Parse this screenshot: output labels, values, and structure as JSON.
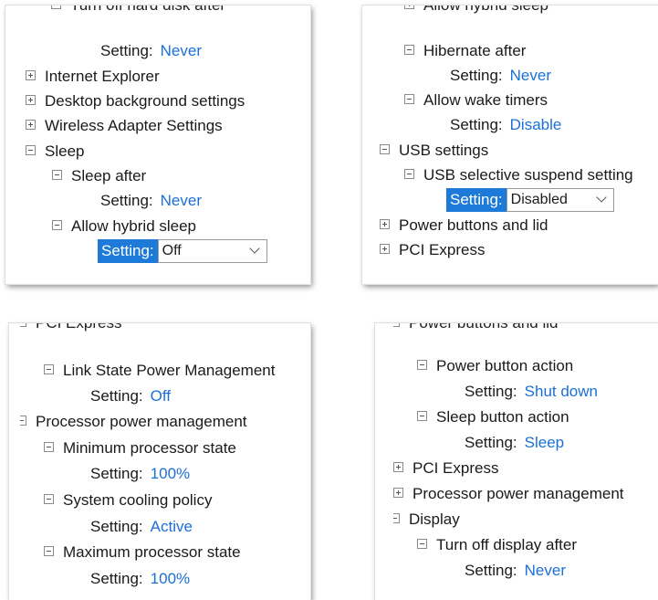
{
  "panel1": {
    "turn_off_hdd": "Turn off hard disk after",
    "setting_label": "Setting:",
    "hdd_value": "Never",
    "internet_explorer": "Internet Explorer",
    "desktop_background": "Desktop background settings",
    "wireless_adapter": "Wireless Adapter Settings",
    "sleep": "Sleep",
    "sleep_after": "Sleep after",
    "sleep_after_value": "Never",
    "allow_hybrid_sleep": "Allow hybrid sleep",
    "hybrid_dropdown_value": "Off"
  },
  "panel2": {
    "allow_hybrid_sleep": "Allow hybrid sleep",
    "hibernate_after": "Hibernate after",
    "setting_label": "Setting:",
    "hibernate_value": "Never",
    "allow_wake_timers": "Allow wake timers",
    "wake_value": "Disable",
    "usb_settings": "USB settings",
    "usb_selective": "USB selective suspend setting",
    "usb_dropdown_value": "Disabled",
    "power_buttons_lid": "Power buttons and lid",
    "pci_express": "PCI Express"
  },
  "panel3": {
    "pci_express": "PCI Express",
    "link_state": "Link State Power Management",
    "setting_label": "Setting:",
    "link_state_value": "Off",
    "processor_pm": "Processor power management",
    "min_processor": "Minimum processor state",
    "min_value": "100%",
    "cooling_policy": "System cooling policy",
    "cooling_value": "Active",
    "max_processor": "Maximum processor state",
    "max_value": "100%"
  },
  "panel4": {
    "power_buttons_lid": "Power buttons and lid",
    "power_button_action": "Power button action",
    "setting_label": "Setting:",
    "power_button_value": "Shut down",
    "sleep_button_action": "Sleep button action",
    "sleep_button_value": "Sleep",
    "pci_express": "PCI Express",
    "processor_pm": "Processor power management",
    "display": "Display",
    "turn_off_display": "Turn off display after",
    "display_value": "Never"
  },
  "colors": {
    "link_blue": "#1b6fd6",
    "selection_blue": "#1e7ad8"
  }
}
